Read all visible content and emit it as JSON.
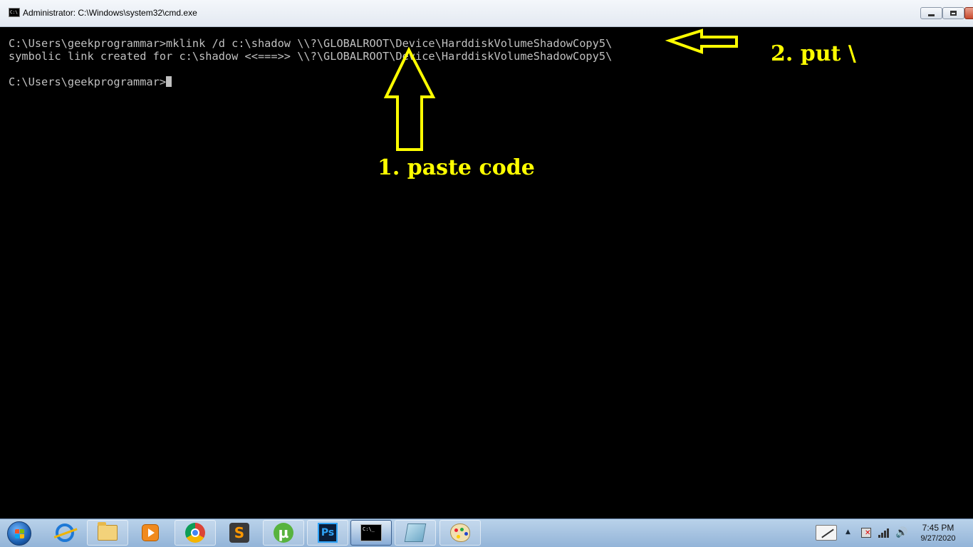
{
  "window": {
    "title": "Administrator: C:\\Windows\\system32\\cmd.exe",
    "icon_text": "C:\\"
  },
  "console": {
    "lines": [
      "C:\\Users\\geekprogrammar>mklink /d c:\\shadow \\\\?\\GLOBALROOT\\Device\\HarddiskVolumeShadowCopy5\\",
      "symbolic link created for c:\\shadow <<===>> \\\\?\\GLOBALROOT\\Device\\HarddiskVolumeShadowCopy5\\",
      "",
      "C:\\Users\\geekprogrammar>"
    ],
    "text_color": "#c0c0c0",
    "background": "#000000"
  },
  "annotations": {
    "label_1": "1. paste code",
    "label_2": "2. put \\",
    "color": "#ffff00"
  },
  "taskbar": {
    "start": "windows-start-orb",
    "items": [
      {
        "name": "internet-explorer",
        "icon": "ie-icon"
      },
      {
        "name": "windows-explorer",
        "icon": "folder-icon"
      },
      {
        "name": "windows-media-player",
        "icon": "media-player-icon"
      },
      {
        "name": "google-chrome",
        "icon": "chrome-icon"
      },
      {
        "name": "sublime-text",
        "icon": "sublime-icon",
        "glyph": "S"
      },
      {
        "name": "utorrent",
        "icon": "utorrent-icon",
        "glyph": "µ"
      },
      {
        "name": "photoshop",
        "icon": "photoshop-icon",
        "glyph": "Ps"
      },
      {
        "name": "command-prompt",
        "icon": "cmd-icon",
        "glyph": "C:\\_"
      },
      {
        "name": "notepad",
        "icon": "notepad-icon"
      },
      {
        "name": "paint",
        "icon": "paint-icon"
      }
    ],
    "clock": {
      "time": "7:45 PM",
      "date": "9/27/2020"
    }
  }
}
